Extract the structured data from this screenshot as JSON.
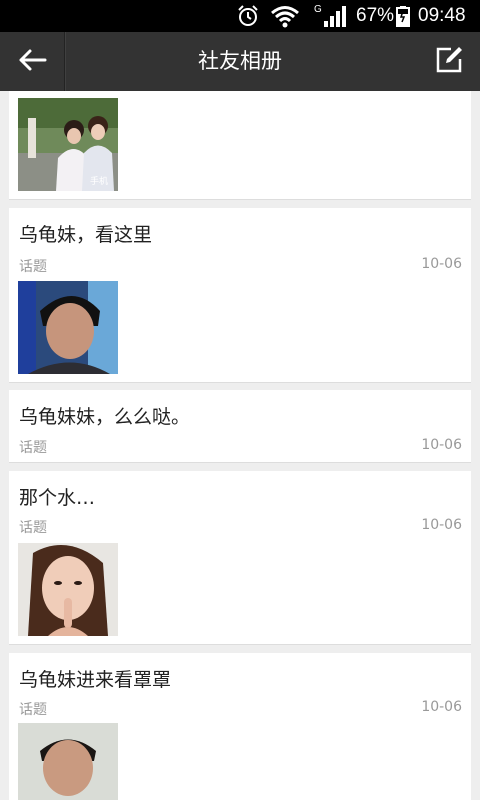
{
  "status_bar": {
    "network": "G",
    "battery_percent": "67%",
    "time": "09:48"
  },
  "header": {
    "title": "社友相册",
    "back_icon": "back-arrow-icon",
    "edit_icon": "edit-icon"
  },
  "posts": [
    {
      "title": "",
      "tag": "",
      "date": "",
      "photo_caption": "手机"
    },
    {
      "title": "乌龟妹，看这里",
      "tag": "话题",
      "date": "10-06"
    },
    {
      "title": "乌龟妹妹，么么哒。",
      "tag": "话题",
      "date": "10-06"
    },
    {
      "title": "那个水…",
      "tag": "话题",
      "date": "10-06"
    },
    {
      "title": "乌龟妹进来看罩罩",
      "tag": "话题",
      "date": "10-06"
    }
  ]
}
